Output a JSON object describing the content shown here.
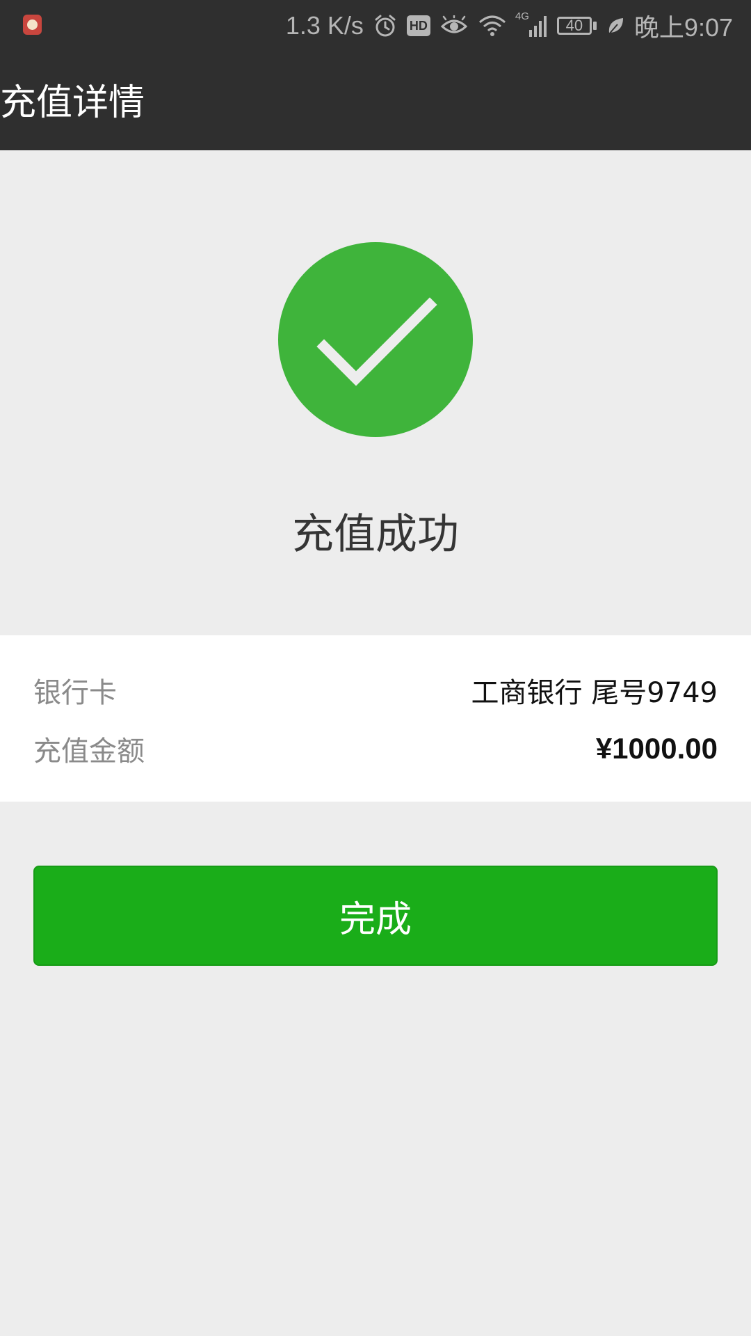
{
  "status_bar": {
    "network_speed": "1.3 K/s",
    "hd_label": "HD",
    "network_type": "4G",
    "battery_level": "40",
    "time": "晚上9:07",
    "icons": [
      "alarm-icon",
      "hd-icon",
      "eye-icon",
      "wifi-icon",
      "signal-icon",
      "battery-icon",
      "leaf-icon"
    ]
  },
  "header": {
    "title": "充值详情"
  },
  "result": {
    "icon": "check-circle-icon",
    "icon_color": "#3fb43b",
    "message": "充值成功"
  },
  "details": {
    "rows": [
      {
        "label": "银行卡",
        "value": "工商银行 尾号9749"
      },
      {
        "label": "充值金额",
        "value": "¥1000.00"
      }
    ]
  },
  "actions": {
    "done_label": "完成",
    "done_color": "#1aad19"
  },
  "colors": {
    "header_bg": "#2f2f2f",
    "page_bg": "#ededed",
    "card_bg": "#ffffff"
  }
}
